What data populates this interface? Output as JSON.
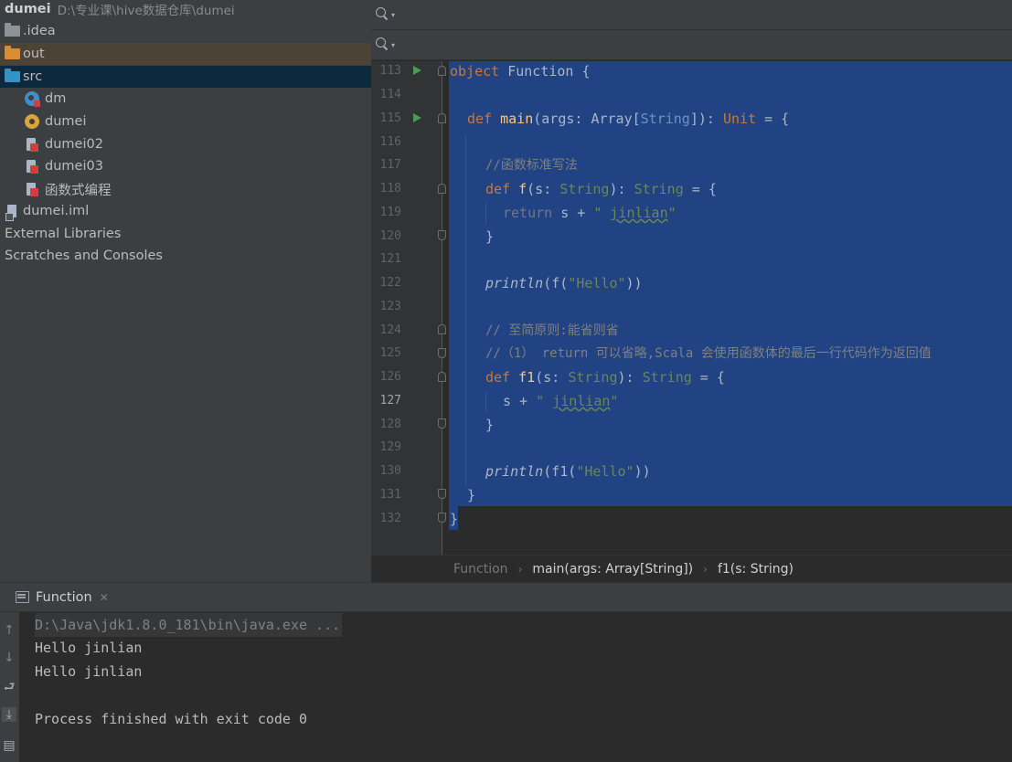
{
  "project_tree": {
    "root": {
      "name": "dumei",
      "path": "D:\\专业课\\hive数据仓库\\dumei"
    },
    "items": [
      {
        "label": ".idea",
        "icon": "folder-icon"
      },
      {
        "label": "out",
        "icon": "folder-excluded-icon"
      },
      {
        "label": "src",
        "icon": "source-folder-icon"
      },
      {
        "label": "dm",
        "icon": "scala-class-icon"
      },
      {
        "label": "dumei",
        "icon": "scala-object-icon"
      },
      {
        "label": "dumei02",
        "icon": "scala-file-icon"
      },
      {
        "label": "dumei03",
        "icon": "scala-file-icon"
      },
      {
        "label": "函数式编程",
        "icon": "scala-file-icon"
      },
      {
        "label": "dumei.iml",
        "icon": "module-file-icon"
      },
      {
        "label": "External Libraries",
        "icon": ""
      },
      {
        "label": "Scratches and Consoles",
        "icon": ""
      }
    ]
  },
  "editor": {
    "line_numbers": [
      "113",
      "114",
      "115",
      "116",
      "117",
      "118",
      "119",
      "120",
      "121",
      "122",
      "123",
      "124",
      "125",
      "126",
      "127",
      "128",
      "129",
      "130",
      "131",
      "132"
    ],
    "current_line": "127",
    "code": {
      "l113": {
        "kw": "object",
        "name": " Function {"
      },
      "l115": {
        "kw": "def ",
        "fn": "main",
        "p1": "(args: Array[",
        "t1": "String",
        "p2": "]): ",
        "t2": "Unit",
        "p3": " = {"
      },
      "l117": "//函数标准写法",
      "l118": {
        "kw": "def ",
        "fn": "f",
        "p1": "(s: ",
        "t1": "String",
        "p2": "): ",
        "t2": "String",
        "p3": " = {"
      },
      "l119": {
        "kw": "return",
        "p1": " s + ",
        "q1": "\" ",
        "w": "jinlian",
        "q2": "\""
      },
      "l120": "}",
      "l122": {
        "fn": "println",
        "p1": "(f(",
        "s": "\"Hello\"",
        "p2": "))"
      },
      "l124": "// 至简原则:能省则省",
      "l125": "//（1） return 可以省略,Scala 会使用函数体的最后一行代码作为返回值",
      "l126": {
        "kw": "def ",
        "fn": "f1",
        "p1": "(s: ",
        "t1": "String",
        "p2": "): ",
        "t2": "String",
        "p3": " = {"
      },
      "l127": {
        "p1": "s + ",
        "q1": "\" ",
        "w": "jinlian",
        "q2": "\""
      },
      "l128": "}",
      "l130": {
        "fn": "println",
        "p1": "(f1(",
        "s": "\"Hello\"",
        "p2": "))"
      },
      "l131": "}",
      "l132": "}"
    }
  },
  "breadcrumb": {
    "items": [
      "Function",
      "main(args: Array[String])",
      "f1(s: String)"
    ]
  },
  "run_panel": {
    "tab_label": "Function",
    "output": [
      "D:\\Java\\jdk1.8.0_181\\bin\\java.exe ...",
      "Hello jinlian",
      "Hello jinlian",
      "",
      "Process finished with exit code 0"
    ]
  },
  "colors": {
    "selection": "#214283",
    "keyword": "#cc7832",
    "function": "#ffc66d",
    "type": "#6897bb",
    "string": "#6a8759",
    "comment": "#808080",
    "run_arrow": "#499c54"
  }
}
